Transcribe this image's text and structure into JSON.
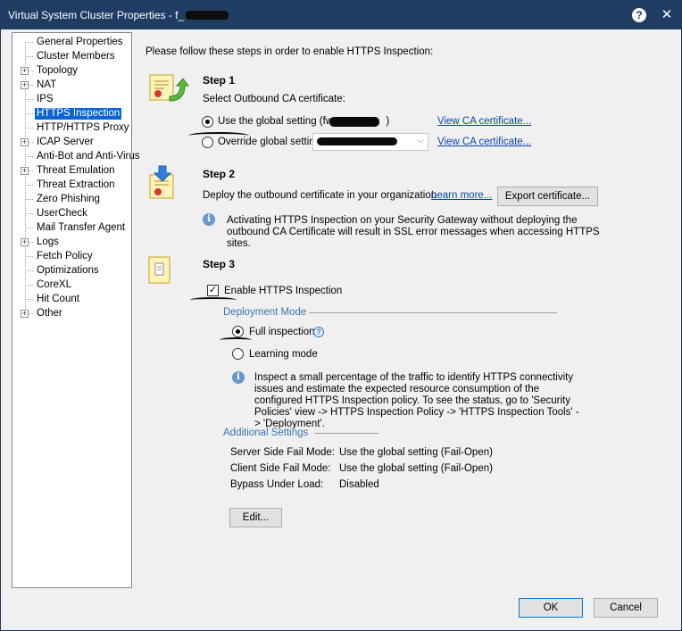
{
  "window": {
    "title": "Virtual System Cluster Properties - f_",
    "help_label": "?",
    "close_label": "✕"
  },
  "tree": [
    {
      "label": "General Properties",
      "expandable": false
    },
    {
      "label": "Cluster Members",
      "expandable": false
    },
    {
      "label": "Topology",
      "expandable": true
    },
    {
      "label": "NAT",
      "expandable": true
    },
    {
      "label": "IPS",
      "expandable": false
    },
    {
      "label": "HTTPS Inspection",
      "expandable": false,
      "selected": true
    },
    {
      "label": "HTTP/HTTPS Proxy",
      "expandable": false
    },
    {
      "label": "ICAP Server",
      "expandable": true
    },
    {
      "label": "Anti-Bot and Anti-Virus",
      "expandable": false
    },
    {
      "label": "Threat Emulation",
      "expandable": true
    },
    {
      "label": "Threat Extraction",
      "expandable": false
    },
    {
      "label": "Zero Phishing",
      "expandable": false
    },
    {
      "label": "UserCheck",
      "expandable": false
    },
    {
      "label": "Mail Transfer Agent",
      "expandable": false
    },
    {
      "label": "Logs",
      "expandable": true
    },
    {
      "label": "Fetch Policy",
      "expandable": false
    },
    {
      "label": "Optimizations",
      "expandable": false
    },
    {
      "label": "CoreXL",
      "expandable": false
    },
    {
      "label": "Hit Count",
      "expandable": false
    },
    {
      "label": "Other",
      "expandable": true
    }
  ],
  "intro": "Please follow these steps in order to enable HTTPS Inspection:",
  "step1": {
    "title": "Step 1",
    "subtitle": "Select Outbound CA certificate:",
    "option_global": "Use the global setting (fwt",
    "option_global_close": ")",
    "option_override": "Override global setting",
    "view_ca_1": "View CA certificate...",
    "view_ca_2": "View CA certificate..."
  },
  "step2": {
    "title": "Step 2",
    "text": "Deploy the outbound certificate in your organization",
    "learn_more": "Learn more...",
    "export_button": "Export certificate...",
    "info": "Activating HTTPS Inspection on your Security Gateway without deploying the outbound CA Certificate will result in SSL error messages when accessing HTTPS sites."
  },
  "step3": {
    "title": "Step 3",
    "enable_label": "Enable HTTPS Inspection",
    "enable_checked": true,
    "deployment_mode_label": "Deployment Mode",
    "full_inspection": "Full inspection",
    "learning_mode": "Learning mode",
    "learning_info": "Inspect a small percentage of the traffic to identify HTTPS connectivity issues and estimate the expected resource consumption of the configured HTTPS Inspection policy. To see the status, go to 'Security Policies' view -> HTTPS Inspection Policy -> 'HTTPS Inspection Tools' -> 'Deployment'.",
    "additional_settings_label": "Additional Settings",
    "settings": [
      {
        "name": "Server Side Fail Mode:",
        "value": "Use the global setting (Fail-Open)"
      },
      {
        "name": "Client Side Fail Mode:",
        "value": "Use the global setting (Fail-Open)"
      },
      {
        "name": "Bypass Under Load:",
        "value": "Disabled"
      }
    ],
    "edit_button": "Edit..."
  },
  "footer": {
    "ok_label": "OK",
    "cancel_label": "Cancel"
  },
  "colors": {
    "titlebar": "#1f3d63",
    "selection": "#0a64d2",
    "link": "#0645ad",
    "group_label": "#3c6fb6"
  }
}
